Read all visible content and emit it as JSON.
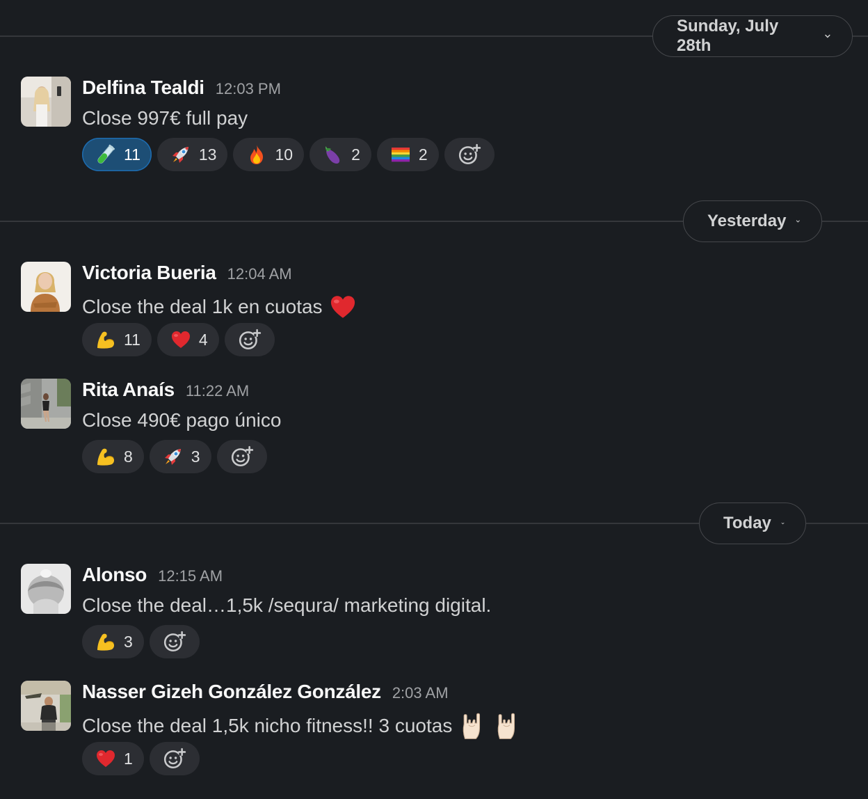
{
  "dividers": [
    {
      "label": "Sunday, July 28th"
    },
    {
      "label": "Yesterday"
    },
    {
      "label": "Today"
    }
  ],
  "messages": [
    {
      "author": "Delfina Tealdi",
      "time": "12:03 PM",
      "text": "Close 997€ full pay",
      "reactions": [
        {
          "emoji": "test-tube",
          "count": "11",
          "mine": true
        },
        {
          "emoji": "rocket",
          "count": "13"
        },
        {
          "emoji": "fire",
          "count": "10"
        },
        {
          "emoji": "eggplant",
          "count": "2"
        },
        {
          "emoji": "rainbow-flag",
          "count": "2"
        }
      ]
    },
    {
      "author": "Victoria Bueria",
      "time": "12:04 AM",
      "text": "Close the deal 1k en cuotas",
      "inline_emoji": [
        "red-heart"
      ],
      "reactions": [
        {
          "emoji": "flexed-biceps",
          "count": "11"
        },
        {
          "emoji": "red-heart",
          "count": "4"
        }
      ]
    },
    {
      "author": "Rita Anaís",
      "time": "11:22 AM",
      "text": "Close 490€ pago único",
      "reactions": [
        {
          "emoji": "flexed-biceps",
          "count": "8"
        },
        {
          "emoji": "rocket",
          "count": "3"
        }
      ]
    },
    {
      "author": "Alonso",
      "time": "12:15 AM",
      "text": "Close the deal…1,5k /sequra/ marketing digital.",
      "reactions": [
        {
          "emoji": "flexed-biceps",
          "count": "3"
        }
      ]
    },
    {
      "author": "Nasser Gizeh González González",
      "time": "2:03 AM",
      "text": "Close the deal 1,5k nicho fitness!! 3 cuotas",
      "inline_emoji": [
        "sign-of-horns",
        "sign-of-horns"
      ],
      "reactions": [
        {
          "emoji": "red-heart",
          "count": "1"
        }
      ]
    }
  ]
}
